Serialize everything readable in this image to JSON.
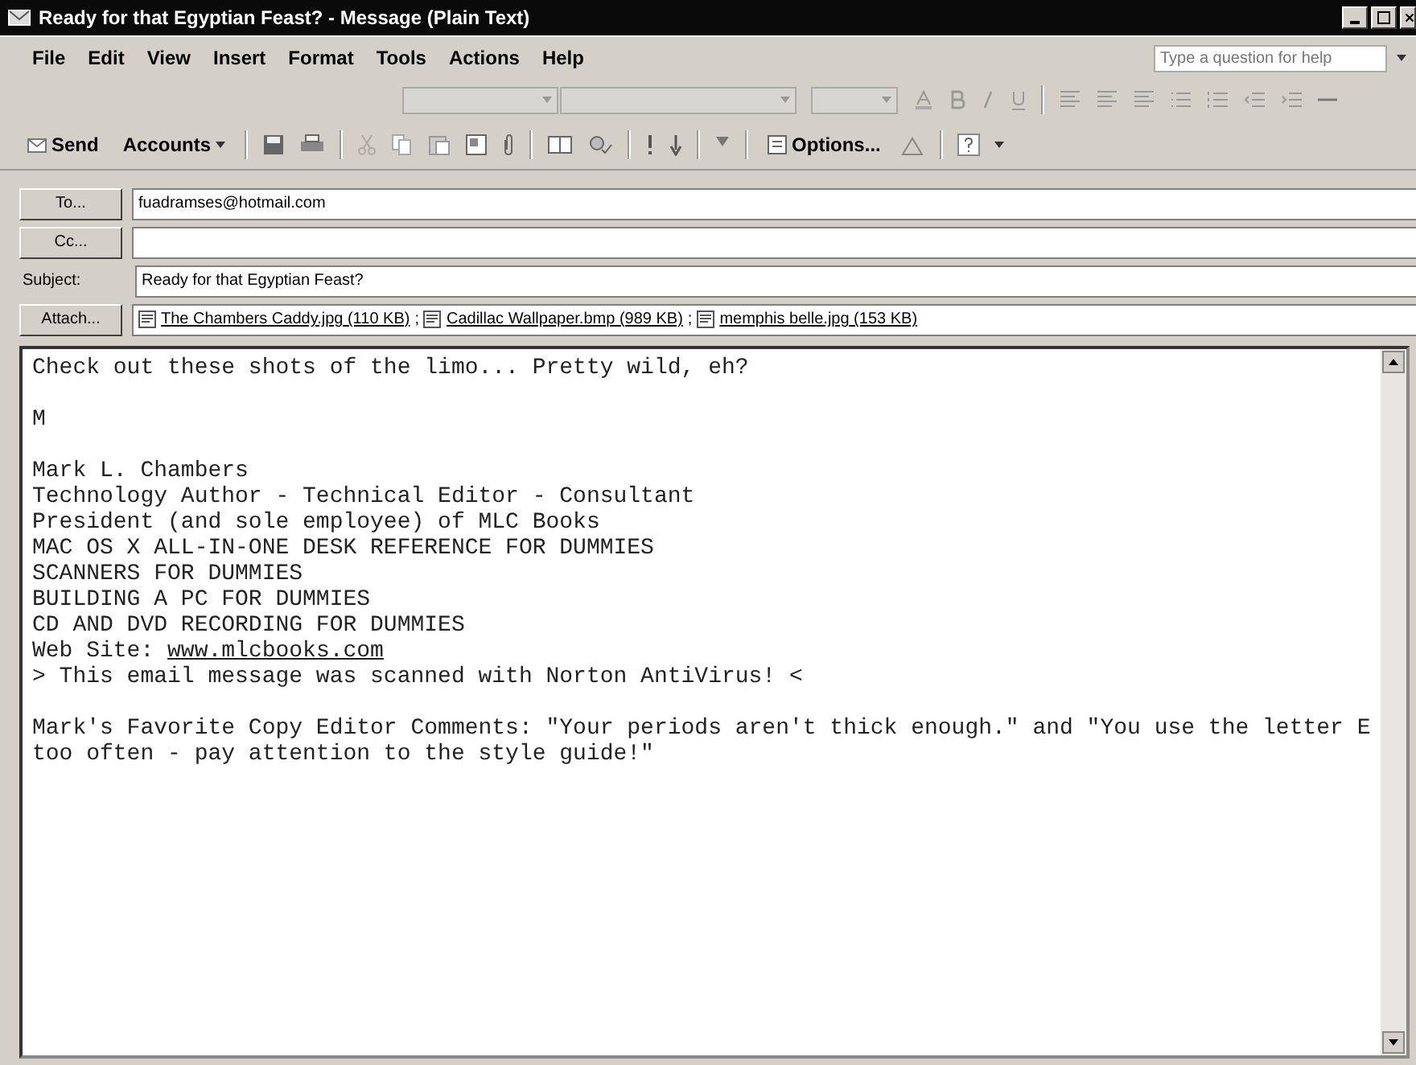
{
  "window": {
    "title": "Ready for that Egyptian Feast? - Message (Plain Text)"
  },
  "menu": [
    "File",
    "Edit",
    "View",
    "Insert",
    "Format",
    "Tools",
    "Actions",
    "Help"
  ],
  "help_search": {
    "placeholder": "Type a question for help"
  },
  "standard_toolbar": {
    "send": "Send",
    "accounts": "Accounts",
    "options": "Options..."
  },
  "header_fields": [
    {
      "kind": "button",
      "label": "To...",
      "value": "fuadramses@hotmail.com"
    },
    {
      "kind": "button",
      "label": "Cc..."
    },
    {
      "kind": "label",
      "label": "Subject:",
      "value": "Ready for that Egyptian Feast?"
    }
  ],
  "attach": {
    "label": "Attach...",
    "separator": ";",
    "files": [
      "The Chambers Caddy.jpg (110 KB)",
      "Cadillac Wallpaper.bmp (989 KB)",
      "memphis belle.jpg (153 KB)"
    ]
  },
  "body": [
    {
      "lines": [
        {
          "kind": "text",
          "text": "Check out these shots of the limo... Pretty wild, eh?"
        }
      ]
    },
    {
      "lines": [
        {
          "kind": "text",
          "text": "M"
        }
      ]
    },
    {
      "lines": [
        {
          "kind": "text",
          "text": "Mark L. Chambers"
        },
        {
          "kind": "text",
          "text": "Technology Author - Technical Editor - Consultant"
        },
        {
          "kind": "text",
          "text": "President (and sole employee) of MLC Books"
        },
        {
          "kind": "text",
          "text": "MAC OS X ALL-IN-ONE DESK REFERENCE FOR DUMMIES"
        },
        {
          "kind": "text",
          "text": "SCANNERS FOR DUMMIES"
        },
        {
          "kind": "text",
          "text": "BUILDING A PC FOR DUMMIES"
        },
        {
          "kind": "text",
          "text": "CD AND DVD RECORDING FOR DUMMIES"
        },
        {
          "kind": "link",
          "text": "Web Site:",
          "link": "www.mlcbooks.com"
        },
        {
          "kind": "text",
          "text": "> This email message was scanned with Norton AntiVirus! <"
        }
      ]
    },
    {
      "lines": [
        {
          "kind": "text",
          "text": "Mark's Favorite Copy Editor Comments: \"Your periods aren't thick enough.\" and \"You use the letter E too often - pay attention to the style guide!\""
        }
      ]
    }
  ]
}
